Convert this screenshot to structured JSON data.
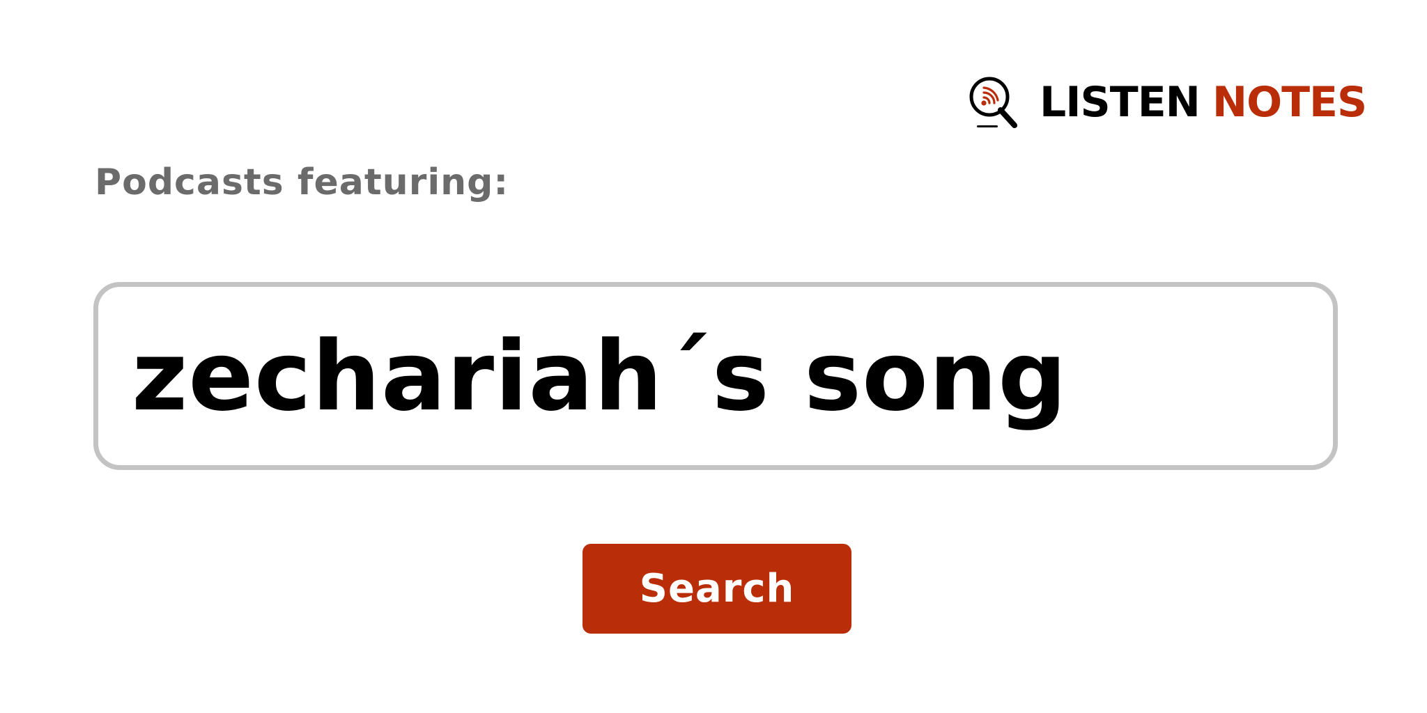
{
  "brand": {
    "word_a": "LISTEN",
    "word_b": "NOTES",
    "icon": "magnifier-podcast-icon",
    "colors": {
      "primary": "#000000",
      "accent": "#b92e08"
    }
  },
  "heading": {
    "text": "Podcasts featuring:",
    "color": "#6b6b6b"
  },
  "search": {
    "value": "zechariah´s song",
    "placeholder": ""
  },
  "button": {
    "label": "Search",
    "color": "#b92e08"
  }
}
